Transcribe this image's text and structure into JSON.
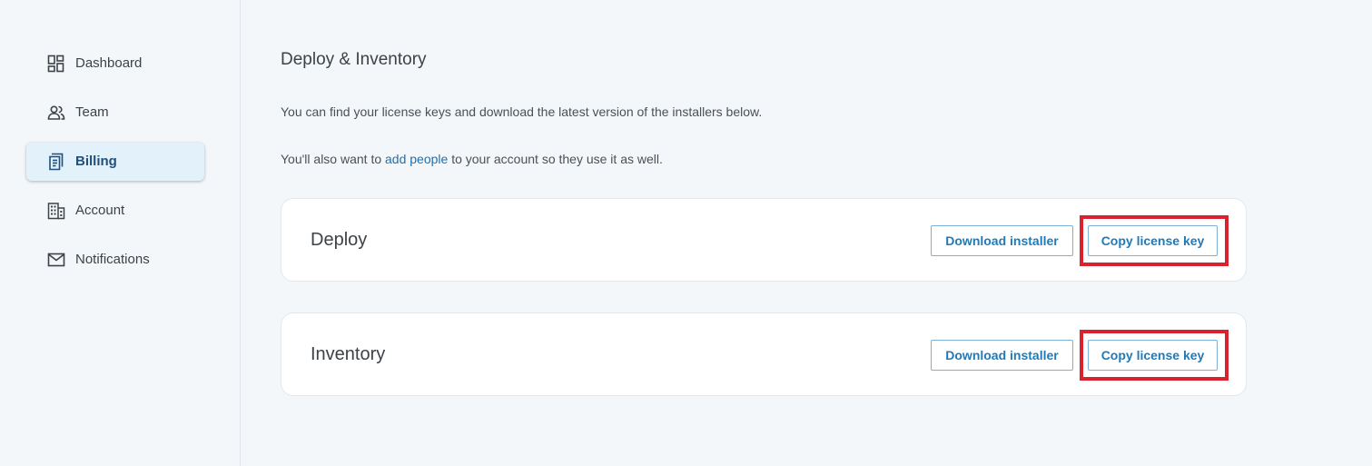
{
  "sidebar": {
    "items": [
      {
        "label": "Dashboard",
        "icon": "dashboard-icon",
        "active": false
      },
      {
        "label": "Team",
        "icon": "team-icon",
        "active": false
      },
      {
        "label": "Billing",
        "icon": "billing-icon",
        "active": true
      },
      {
        "label": "Account",
        "icon": "account-icon",
        "active": false
      },
      {
        "label": "Notifications",
        "icon": "mail-icon",
        "active": false
      }
    ]
  },
  "main": {
    "title": "Deploy & Inventory",
    "intro": "You can find your license keys and download the latest version of the installers below.",
    "people_prefix": "You'll also want to ",
    "people_link": "add people",
    "people_suffix": " to your account so they use it as well.",
    "cards": [
      {
        "title": "Deploy",
        "download_label": "Download installer",
        "copy_label": "Copy license key"
      },
      {
        "title": "Inventory",
        "download_label": "Download installer",
        "copy_label": "Copy license key"
      }
    ]
  },
  "colors": {
    "background": "#f3f7fa",
    "accent": "#1f7ab8",
    "link": "#1f6fae",
    "active_nav": "#e3f1fb",
    "highlight": "#d9222e"
  }
}
